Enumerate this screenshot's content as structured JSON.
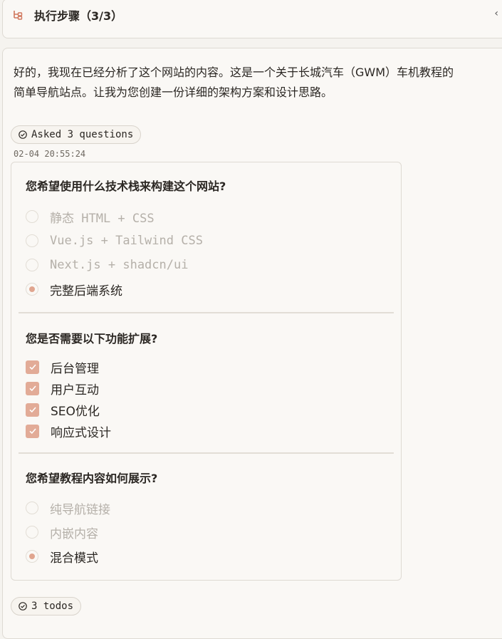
{
  "step": {
    "title": "执行步骤（3/3）",
    "icon": "tree-structure-icon",
    "accent": "#d0765c"
  },
  "message": {
    "intro": "好的，我现在已经分析了这个网站的内容。这是一个关于长城汽车（GWM）车机教程的\n简单导航站点。让我为您创建一份详细的架构方案和设计思路。"
  },
  "asked_pill": "Asked 3 questions",
  "timestamp": "02-04 20:55:24",
  "questions": [
    {
      "title": "您希望使用什么技术栈来构建这个网站?",
      "type": "radio",
      "options": [
        {
          "label": "静态 HTML + CSS",
          "selected": false,
          "mono": true
        },
        {
          "label": "Vue.js + Tailwind CSS",
          "selected": false,
          "mono": true
        },
        {
          "label": "Next.js + shadcn/ui",
          "selected": false,
          "mono": true
        },
        {
          "label": "完整后端系统",
          "selected": true,
          "mono": false
        }
      ]
    },
    {
      "title": "您是否需要以下功能扩展?",
      "type": "checkbox",
      "options": [
        {
          "label": "后台管理",
          "checked": true
        },
        {
          "label": "用户互动",
          "checked": true
        },
        {
          "label": "SEO优化",
          "checked": true
        },
        {
          "label": "响应式设计",
          "checked": true
        }
      ]
    },
    {
      "title": "您希望教程内容如何展示?",
      "type": "radio",
      "options": [
        {
          "label": "纯导航链接",
          "selected": false
        },
        {
          "label": "内嵌内容",
          "selected": false
        },
        {
          "label": "混合模式",
          "selected": true
        }
      ]
    }
  ],
  "todos_pill": "3 todos",
  "colors": {
    "selection": "#e0a58f",
    "checkbox": "#e2ab97",
    "background": "#f5f3ef"
  }
}
